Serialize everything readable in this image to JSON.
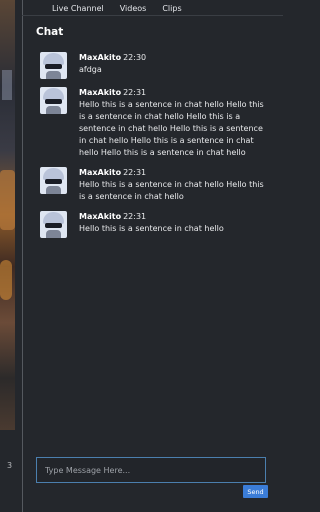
{
  "tabs": [
    {
      "label": "Live Channel",
      "active": true
    },
    {
      "label": "Videos",
      "active": false
    },
    {
      "label": "Clips",
      "active": false
    }
  ],
  "chat": {
    "title": "Chat",
    "messages": [
      {
        "user": "MaxAkito",
        "time": "22:30",
        "text": "afdga"
      },
      {
        "user": "MaxAkito",
        "time": "22:31",
        "text": "Hello this is a sentence in chat hello Hello this is a sentence in chat hello Hello this is a sentence in chat hello Hello this is a sentence in chat hello Hello this is a sentence in chat hello Hello this is a sentence in chat hello"
      },
      {
        "user": "MaxAkito",
        "time": "22:31",
        "text": "Hello this is a sentence in chat hello Hello this is a sentence in chat hello"
      },
      {
        "user": "MaxAkito",
        "time": "22:31",
        "text": "Hello this is a sentence in chat hello"
      }
    ],
    "input_placeholder": "Type Message Here...",
    "input_value": "",
    "send_label": "Send"
  },
  "left_panel": {
    "page_number": "3"
  },
  "colors": {
    "accent": "#3b7dd8",
    "background": "#24272c"
  }
}
